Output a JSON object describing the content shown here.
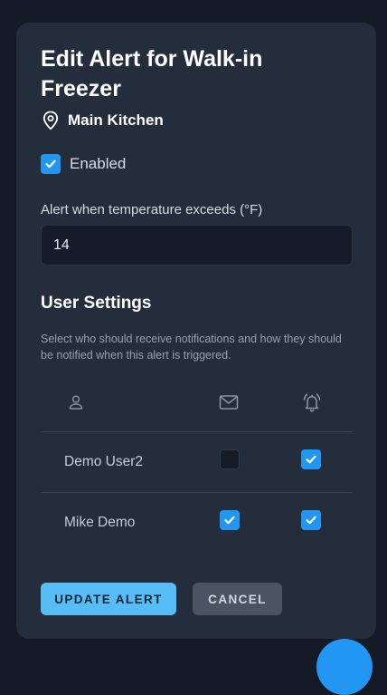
{
  "modal": {
    "title": "Edit Alert for Walk-in Freezer",
    "location": "Main Kitchen",
    "enabled_label": "Enabled",
    "enabled": true,
    "threshold_label": "Alert when temperature exceeds (°F)",
    "threshold_value": "14"
  },
  "user_settings": {
    "title": "User Settings",
    "description": "Select who should receive notifications and how they should be notified when this alert is triggered.",
    "columns": [
      "user-icon",
      "mail-icon",
      "bell-icon"
    ],
    "rows": [
      {
        "name": "Demo User2",
        "email": false,
        "alert": true
      },
      {
        "name": "Mike Demo",
        "email": true,
        "alert": true
      }
    ]
  },
  "actions": {
    "update_label": "UPDATE ALERT",
    "cancel_label": "CANCEL"
  },
  "colors": {
    "accent": "#2196f3",
    "primary_button": "#56bdf6",
    "panel": "#232d3b"
  }
}
